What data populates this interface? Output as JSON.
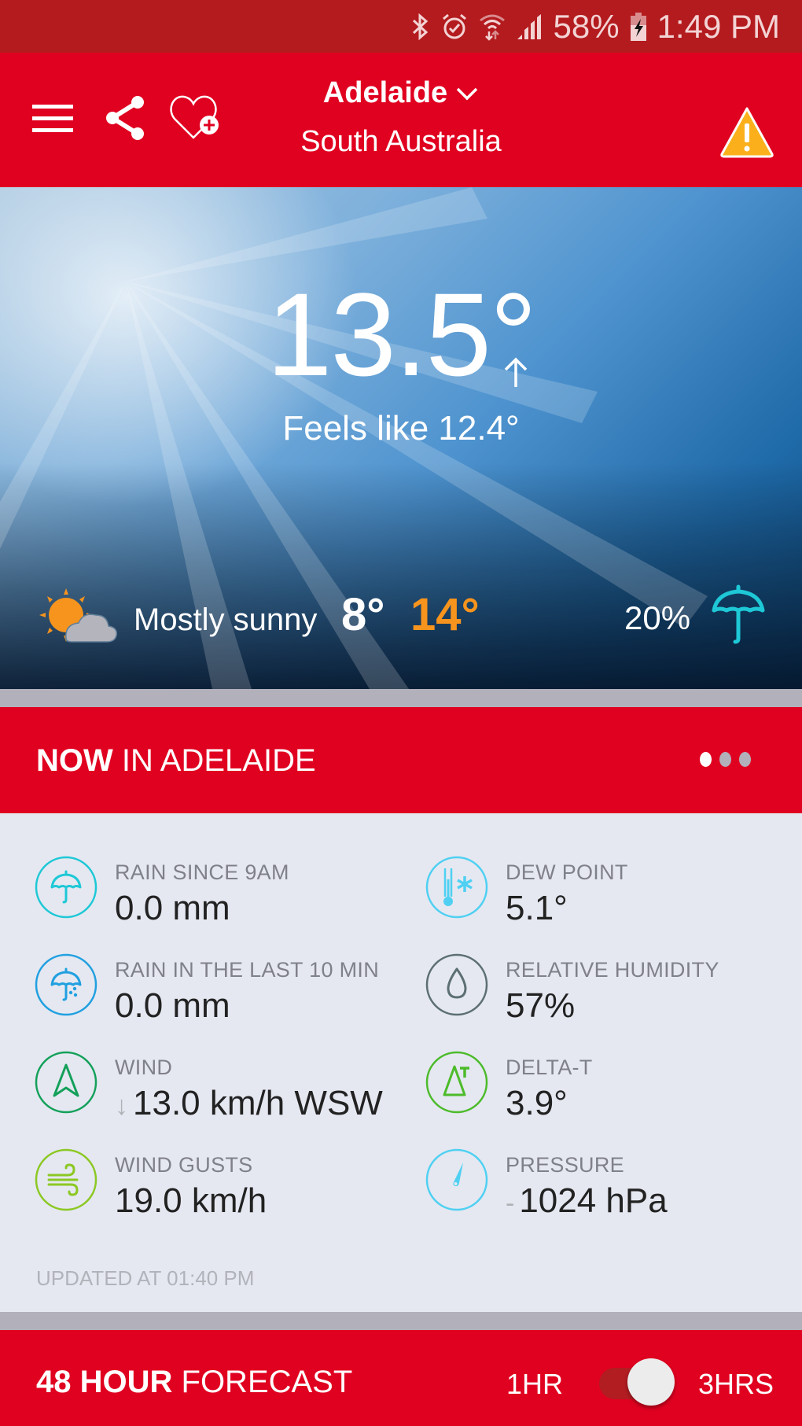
{
  "status_bar": {
    "battery": "58%",
    "time": "1:49 PM",
    "icons": [
      "bluetooth-icon",
      "alarm-icon",
      "wifi-icon",
      "signal-icon",
      "battery-charging-icon"
    ]
  },
  "app_bar": {
    "city": "Adelaide",
    "state": "South Australia",
    "icons": [
      "menu-icon",
      "share-icon",
      "add-favourite-icon",
      "chevron-down-icon",
      "warning-icon"
    ]
  },
  "current": {
    "temperature": "13.5°",
    "trend": "rising",
    "feels_like": "Feels like 12.4°",
    "condition": "Mostly sunny",
    "min": "8°",
    "max": "14°",
    "rain_chance": "20%",
    "colors": {
      "max": "#f7941d",
      "umbrella": "#1ec8d6"
    }
  },
  "now_section": {
    "title_bold": "NOW",
    "title_rest": " IN ADELAIDE",
    "pager": {
      "count": 3,
      "active": 0
    },
    "observations": [
      {
        "label": "RAIN SINCE 9AM",
        "value": "0.0 mm",
        "icon": "umbrella-icon",
        "color": "#1ec8d6"
      },
      {
        "label": "DEW POINT",
        "value": "5.1°",
        "icon": "thermometer-snow-icon",
        "color": "#4fd0f2"
      },
      {
        "label": "RAIN IN THE LAST 10 MIN",
        "value": "0.0 mm",
        "icon": "umbrella-rain-icon",
        "color": "#21a0e0"
      },
      {
        "label": "RELATIVE HUMIDITY",
        "value": "57%",
        "icon": "water-drop-icon",
        "color": "#5c6f73"
      },
      {
        "label": "WIND",
        "prefix": "↓",
        "value": "13.0 km/h WSW",
        "icon": "wind-direction-icon",
        "color": "#14a05a"
      },
      {
        "label": "DELTA-T",
        "value": "3.9°",
        "icon": "delta-t-icon",
        "color": "#4cbb2a"
      },
      {
        "label": "WIND GUSTS",
        "value": "19.0 km/h",
        "icon": "wind-gusts-icon",
        "color": "#8cc823"
      },
      {
        "label": "PRESSURE",
        "prefix": "-",
        "value": "1024 hPa",
        "icon": "pressure-gauge-icon",
        "color": "#4fd0f2"
      }
    ],
    "updated": "UPDATED AT 01:40 PM"
  },
  "forecast_section": {
    "title_bold": "48 HOUR",
    "title_rest": " FORECAST",
    "option_left": "1HR",
    "option_right": "3HRS",
    "selected": "3HRS"
  }
}
